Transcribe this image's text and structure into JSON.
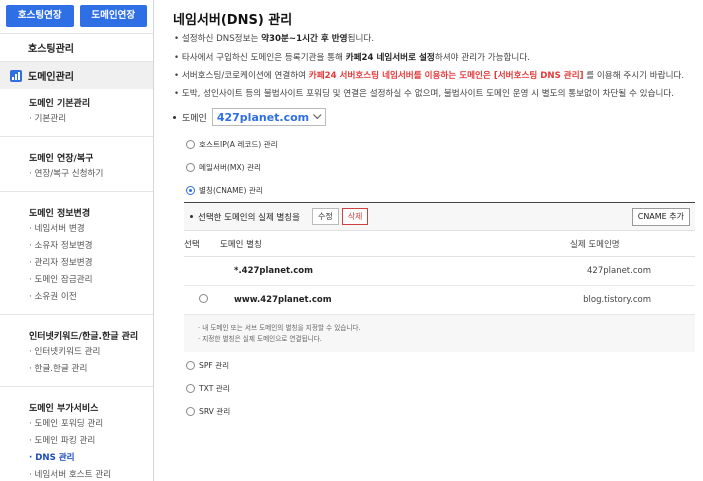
{
  "sidebar": {
    "top_buttons": [
      "호스팅연장",
      "도메인연장"
    ],
    "main_items": [
      {
        "label": "호스팅관리",
        "icon": "grid-icon"
      },
      {
        "label": "도메인관리",
        "icon": "chart-icon",
        "active": true
      }
    ],
    "groups": [
      {
        "title": "도메인 기본관리",
        "items": [
          "기본관리"
        ]
      },
      {
        "title": "도메인 연장/복구",
        "items": [
          "연장/복구 신청하기"
        ]
      },
      {
        "title": "도메인 정보변경",
        "items": [
          "네임서버 변경",
          "소유자 정보변경",
          "관리자 정보변경",
          "도메인 잠금관리",
          "소유권 이전"
        ]
      },
      {
        "title": "인터넷키워드/한글.한글 관리",
        "items": [
          "인터넷키워드 관리",
          "한글.한글 관리"
        ]
      },
      {
        "title": "도메인 부가서비스",
        "items": [
          "도메인 포워딩 관리",
          "도메인 파킹 관리",
          "DNS 관리",
          "네임서버 호스트 관리"
        ],
        "active_index": 2
      }
    ]
  },
  "main": {
    "title": "네임서버(DNS) 관리",
    "notices": [
      {
        "pre": "설정하신 DNS정보는 ",
        "bold": "약30분~1시간 후 반영",
        "post": "됩니다."
      },
      {
        "pre": "타사에서 구입하신 도메인은 등록기관을 통해 ",
        "bold": "카페24 네임서버로 설정",
        "post": "하셔야 관리가 가능합니다."
      },
      {
        "pre": "서버호스팅/코로케이션에 연결하여 ",
        "red": "카페24 서버호스팅 네임서버를 이용하는 도메인은 [서버호스팅 DNS 관리]",
        "post": " 를 이용해 주시기 바랍니다."
      },
      {
        "pre": "도박, 성인사이트 등의 불법사이트 포워딩 및 연결은 설정하실 수 없으며, 불법사이트 도메인 운영 시 별도의 통보없이 차단될 수 있습니다.",
        "bold": "",
        "post": ""
      }
    ],
    "domain_label": "도메인",
    "domain_value": "427planet.com",
    "record_types": [
      {
        "label": "호스트IP(A 레코드) 관리",
        "checked": false
      },
      {
        "label": "메일서버(MX) 관리",
        "checked": false
      },
      {
        "label": "별칭(CNAME) 관리",
        "checked": true
      }
    ],
    "cname": {
      "heading": "선택한 도메인의 실제 별칭을",
      "edit_label": "수정",
      "delete_label": "삭제",
      "add_label": "CNAME 추가",
      "columns": [
        "선택",
        "도메인 별칭",
        "실제 도메인명"
      ],
      "rows": [
        {
          "alias": "*.427planet.com",
          "real": "427planet.com",
          "selectable": false
        },
        {
          "alias": "www.427planet.com",
          "real": "blog.tistory.com",
          "selectable": true
        }
      ],
      "help": [
        "· 내 도메인 또는 서브 도메인의 별칭을 지정할 수 있습니다.",
        "· 지정한 별칭은 실제 도메인으로 연결됩니다."
      ]
    },
    "bottom_types": [
      {
        "label": "SPF 관리"
      },
      {
        "label": "TXT 관리"
      },
      {
        "label": "SRV 관리"
      }
    ],
    "colors": {
      "accent": "#2f6fe6",
      "danger": "#e23b3b"
    }
  }
}
